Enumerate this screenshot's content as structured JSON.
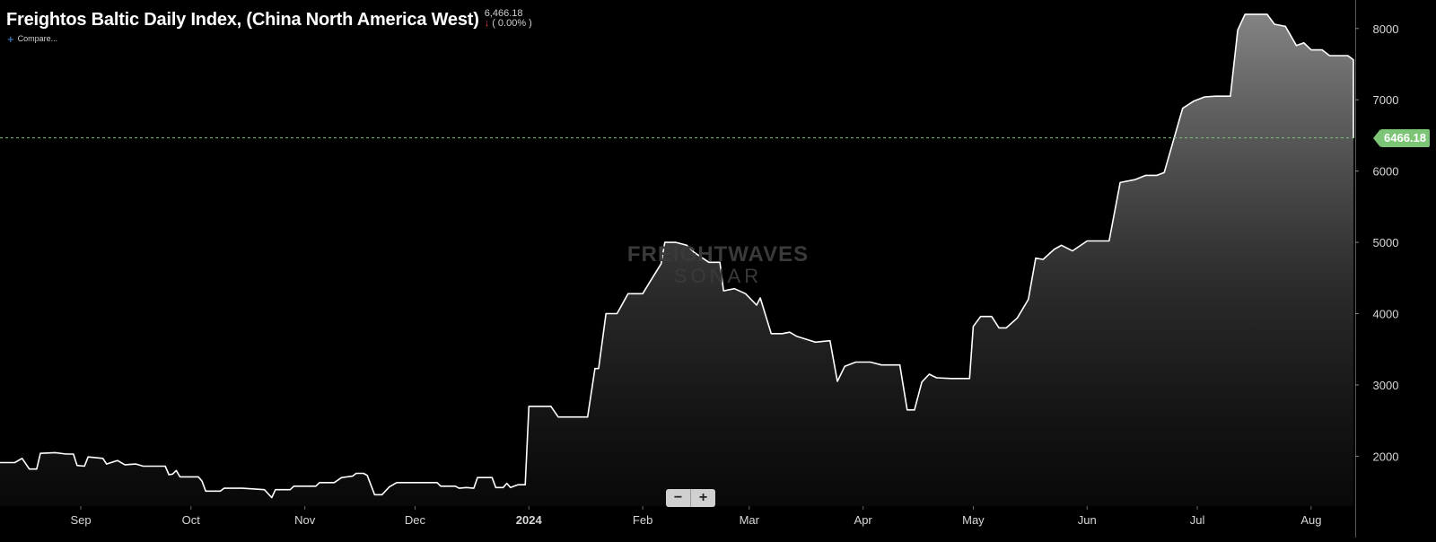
{
  "header": {
    "title": "Freightos Baltic Daily Index, (China North America West)",
    "last_value": "6,466.18",
    "change": "( 0.00% )",
    "compare_label": "Compare..."
  },
  "watermark": {
    "line1": "FREIGHTWAVES",
    "line2": "SONAR"
  },
  "zoom": {
    "minus": "−",
    "plus": "+"
  },
  "price_tag": "6466.18",
  "colors": {
    "line": "#ffffff",
    "last_price": "#7cc576",
    "change_down": "#e04848",
    "background": "#000000"
  },
  "chart_data": {
    "type": "area",
    "title": "Freightos Baltic Daily Index, (China North America West)",
    "xlabel": "",
    "ylabel": "",
    "x_range": [
      "2023-08-10",
      "2024-08-13"
    ],
    "ylim": [
      1300,
      8400
    ],
    "y_ticks": [
      2000,
      3000,
      4000,
      5000,
      6000,
      7000,
      8000
    ],
    "x_ticks": [
      {
        "date": "2023-09-01",
        "label": "Sep"
      },
      {
        "date": "2023-10-01",
        "label": "Oct"
      },
      {
        "date": "2023-11-01",
        "label": "Nov"
      },
      {
        "date": "2023-12-01",
        "label": "Dec"
      },
      {
        "date": "2024-01-01",
        "label": "2024"
      },
      {
        "date": "2024-02-01",
        "label": "Feb"
      },
      {
        "date": "2024-03-01",
        "label": "Mar"
      },
      {
        "date": "2024-04-01",
        "label": "Apr"
      },
      {
        "date": "2024-05-01",
        "label": "May"
      },
      {
        "date": "2024-06-01",
        "label": "Jun"
      },
      {
        "date": "2024-07-01",
        "label": "Jul"
      },
      {
        "date": "2024-08-01",
        "label": "Aug"
      }
    ],
    "last_value": 6466.18,
    "grid": false,
    "legend": "none",
    "series": [
      {
        "points": [
          [
            "2023-08-10",
            1910
          ],
          [
            "2023-08-14",
            1910
          ],
          [
            "2023-08-16",
            1970
          ],
          [
            "2023-08-18",
            1820
          ],
          [
            "2023-08-20",
            1820
          ],
          [
            "2023-08-21",
            2040
          ],
          [
            "2023-08-25",
            2050
          ],
          [
            "2023-08-28",
            2030
          ],
          [
            "2023-08-30",
            2030
          ],
          [
            "2023-08-31",
            1870
          ],
          [
            "2023-09-02",
            1860
          ],
          [
            "2023-09-03",
            1990
          ],
          [
            "2023-09-07",
            1970
          ],
          [
            "2023-09-08",
            1890
          ],
          [
            "2023-09-11",
            1940
          ],
          [
            "2023-09-13",
            1880
          ],
          [
            "2023-09-16",
            1890
          ],
          [
            "2023-09-18",
            1860
          ],
          [
            "2023-09-24",
            1860
          ],
          [
            "2023-09-25",
            1740
          ],
          [
            "2023-09-26",
            1750
          ],
          [
            "2023-09-27",
            1800
          ],
          [
            "2023-09-28",
            1710
          ],
          [
            "2023-10-03",
            1710
          ],
          [
            "2023-10-04",
            1650
          ],
          [
            "2023-10-05",
            1510
          ],
          [
            "2023-10-09",
            1510
          ],
          [
            "2023-10-10",
            1550
          ],
          [
            "2023-10-15",
            1550
          ],
          [
            "2023-10-21",
            1530
          ],
          [
            "2023-10-23",
            1420
          ],
          [
            "2023-10-24",
            1530
          ],
          [
            "2023-10-28",
            1530
          ],
          [
            "2023-10-29",
            1580
          ],
          [
            "2023-11-01",
            1580
          ],
          [
            "2023-11-04",
            1580
          ],
          [
            "2023-11-05",
            1630
          ],
          [
            "2023-11-09",
            1630
          ],
          [
            "2023-11-11",
            1700
          ],
          [
            "2023-11-14",
            1720
          ],
          [
            "2023-11-15",
            1760
          ],
          [
            "2023-11-17",
            1760
          ],
          [
            "2023-11-18",
            1730
          ],
          [
            "2023-11-20",
            1460
          ],
          [
            "2023-11-22",
            1460
          ],
          [
            "2023-11-24",
            1570
          ],
          [
            "2023-11-26",
            1630
          ],
          [
            "2023-12-01",
            1630
          ],
          [
            "2023-12-07",
            1630
          ],
          [
            "2023-12-08",
            1580
          ],
          [
            "2023-12-12",
            1580
          ],
          [
            "2023-12-13",
            1550
          ],
          [
            "2023-12-15",
            1560
          ],
          [
            "2023-12-17",
            1550
          ],
          [
            "2023-12-18",
            1700
          ],
          [
            "2023-12-22",
            1700
          ],
          [
            "2023-12-23",
            1560
          ],
          [
            "2023-12-25",
            1560
          ],
          [
            "2023-12-26",
            1620
          ],
          [
            "2023-12-27",
            1560
          ],
          [
            "2023-12-29",
            1600
          ],
          [
            "2023-12-31",
            1600
          ],
          [
            "2024-01-01",
            2700
          ],
          [
            "2024-01-07",
            2700
          ],
          [
            "2024-01-09",
            2550
          ],
          [
            "2024-01-17",
            2550
          ],
          [
            "2024-01-19",
            3230
          ],
          [
            "2024-01-20",
            3230
          ],
          [
            "2024-01-22",
            4000
          ],
          [
            "2024-01-25",
            4000
          ],
          [
            "2024-01-28",
            4280
          ],
          [
            "2024-02-01",
            4280
          ],
          [
            "2024-02-03",
            4450
          ],
          [
            "2024-02-06",
            4700
          ],
          [
            "2024-02-07",
            5000
          ],
          [
            "2024-02-10",
            5000
          ],
          [
            "2024-02-13",
            4960
          ],
          [
            "2024-02-15",
            4860
          ],
          [
            "2024-02-19",
            4720
          ],
          [
            "2024-02-22",
            4720
          ],
          [
            "2024-02-23",
            4320
          ],
          [
            "2024-02-26",
            4350
          ],
          [
            "2024-02-29",
            4280
          ],
          [
            "2024-03-03",
            4120
          ],
          [
            "2024-03-04",
            4220
          ],
          [
            "2024-03-07",
            3720
          ],
          [
            "2024-03-10",
            3720
          ],
          [
            "2024-03-12",
            3740
          ],
          [
            "2024-03-14",
            3680
          ],
          [
            "2024-03-19",
            3600
          ],
          [
            "2024-03-23",
            3620
          ],
          [
            "2024-03-25",
            3050
          ],
          [
            "2024-03-27",
            3260
          ],
          [
            "2024-03-30",
            3320
          ],
          [
            "2024-04-03",
            3320
          ],
          [
            "2024-04-06",
            3280
          ],
          [
            "2024-04-11",
            3280
          ],
          [
            "2024-04-13",
            2650
          ],
          [
            "2024-04-15",
            2650
          ],
          [
            "2024-04-17",
            3040
          ],
          [
            "2024-04-19",
            3150
          ],
          [
            "2024-04-21",
            3100
          ],
          [
            "2024-04-25",
            3090
          ],
          [
            "2024-04-30",
            3090
          ],
          [
            "2024-05-01",
            3820
          ],
          [
            "2024-05-03",
            3960
          ],
          [
            "2024-05-06",
            3960
          ],
          [
            "2024-05-08",
            3800
          ],
          [
            "2024-05-10",
            3800
          ],
          [
            "2024-05-13",
            3940
          ],
          [
            "2024-05-16",
            4200
          ],
          [
            "2024-05-18",
            4780
          ],
          [
            "2024-05-20",
            4760
          ],
          [
            "2024-05-23",
            4900
          ],
          [
            "2024-05-25",
            4960
          ],
          [
            "2024-05-28",
            4880
          ],
          [
            "2024-06-01",
            5020
          ],
          [
            "2024-06-07",
            5020
          ],
          [
            "2024-06-10",
            5840
          ],
          [
            "2024-06-14",
            5880
          ],
          [
            "2024-06-17",
            5940
          ],
          [
            "2024-06-20",
            5940
          ],
          [
            "2024-06-22",
            5980
          ],
          [
            "2024-06-27",
            6880
          ],
          [
            "2024-06-30",
            6980
          ],
          [
            "2024-07-03",
            7040
          ],
          [
            "2024-07-06",
            7050
          ],
          [
            "2024-07-10",
            7050
          ],
          [
            "2024-07-12",
            7980
          ],
          [
            "2024-07-14",
            8200
          ],
          [
            "2024-07-20",
            8200
          ],
          [
            "2024-07-22",
            8060
          ],
          [
            "2024-07-25",
            8030
          ],
          [
            "2024-07-28",
            7760
          ],
          [
            "2024-07-30",
            7800
          ],
          [
            "2024-08-01",
            7700
          ],
          [
            "2024-08-04",
            7700
          ],
          [
            "2024-08-06",
            7620
          ],
          [
            "2024-08-11",
            7620
          ],
          [
            "2024-08-13",
            7560
          ],
          [
            "2024-08-15",
            7160
          ],
          [
            "2024-08-18",
            7140
          ],
          [
            "2024-08-21",
            6500
          ],
          [
            "2024-08-24",
            6466.18
          ],
          [
            "2024-08-26",
            6466.18
          ]
        ]
      }
    ]
  }
}
